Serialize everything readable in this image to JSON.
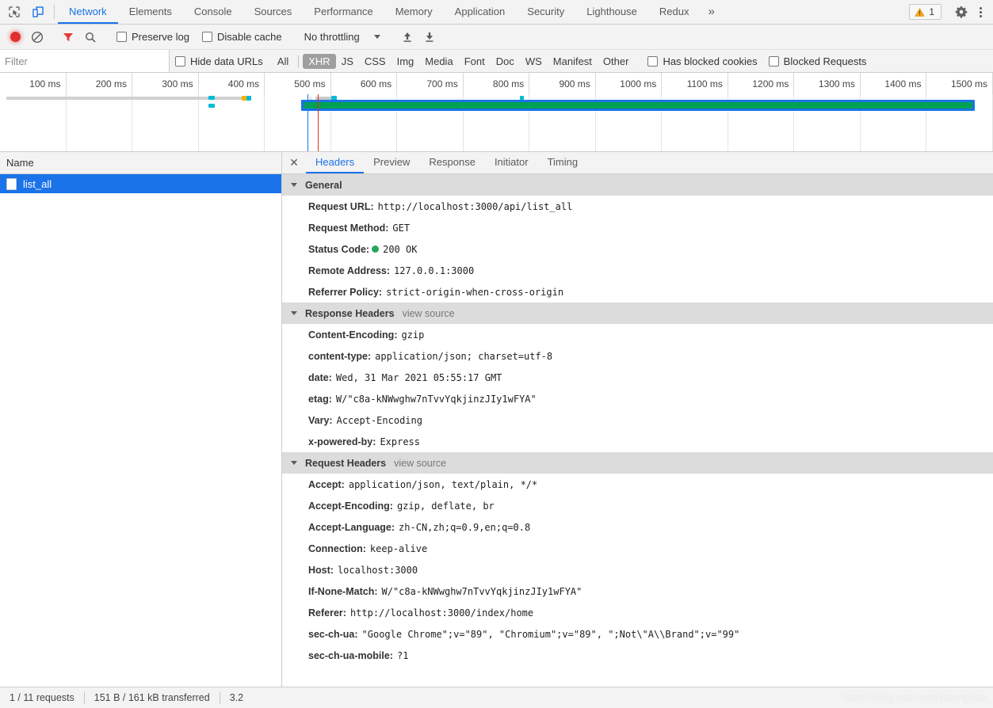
{
  "window": {
    "inspect_icon": "inspect-cursor-icon",
    "device_icon": "device-toolbar-icon"
  },
  "main_tabs": [
    {
      "label": "Network",
      "active": true
    },
    {
      "label": "Elements",
      "active": false
    },
    {
      "label": "Console",
      "active": false
    },
    {
      "label": "Sources",
      "active": false
    },
    {
      "label": "Performance",
      "active": false
    },
    {
      "label": "Memory",
      "active": false
    },
    {
      "label": "Application",
      "active": false
    },
    {
      "label": "Security",
      "active": false
    },
    {
      "label": "Lighthouse",
      "active": false
    },
    {
      "label": "Redux",
      "active": false
    }
  ],
  "main_tabs_overflow": "»",
  "warnings": {
    "count": "1",
    "icon": "warning-triangle-icon"
  },
  "settings_icon": "gear-icon",
  "more_icon": "kebab-menu-icon",
  "controls": {
    "record_icon": "record-button-icon",
    "clear_icon": "clear-icon",
    "filter_icon": "filter-funnel-icon",
    "search_icon": "search-icon",
    "preserve_log": "Preserve log",
    "disable_cache": "Disable cache",
    "throttling": "No throttling",
    "import_icon": "import-har-icon",
    "export_icon": "export-har-icon"
  },
  "filterbar": {
    "placeholder": "Filter",
    "value": "",
    "hide_data_urls": "Hide data URLs",
    "types": [
      {
        "label": "All",
        "selected": false
      },
      {
        "label": "XHR",
        "selected": true
      },
      {
        "label": "JS",
        "selected": false
      },
      {
        "label": "CSS",
        "selected": false
      },
      {
        "label": "Img",
        "selected": false
      },
      {
        "label": "Media",
        "selected": false
      },
      {
        "label": "Font",
        "selected": false
      },
      {
        "label": "Doc",
        "selected": false
      },
      {
        "label": "WS",
        "selected": false
      },
      {
        "label": "Manifest",
        "selected": false
      },
      {
        "label": "Other",
        "selected": false
      }
    ],
    "has_blocked_cookies": "Has blocked cookies",
    "blocked_requests": "Blocked Requests"
  },
  "overview": {
    "ticks": [
      "100 ms",
      "200 ms",
      "300 ms",
      "400 ms",
      "500 ms",
      "600 ms",
      "700 ms",
      "800 ms",
      "900 ms",
      "1000 ms",
      "1100 ms",
      "1200 ms",
      "1300 ms",
      "1400 ms",
      "1500 ms"
    ],
    "dom_content_loaded_color": "#1a73e8",
    "load_event_color": "#d93025",
    "request_color": "#00bcd4",
    "selected_request_color": "#00a152"
  },
  "requests_panel": {
    "column_header": "Name",
    "rows": [
      {
        "name": "list_all",
        "selected": true
      }
    ]
  },
  "detail_tabs": [
    {
      "label": "Headers",
      "active": true
    },
    {
      "label": "Preview",
      "active": false
    },
    {
      "label": "Response",
      "active": false
    },
    {
      "label": "Initiator",
      "active": false
    },
    {
      "label": "Timing",
      "active": false
    }
  ],
  "sections": [
    {
      "title": "General",
      "view_source": "",
      "rows": [
        {
          "key": "Request URL:",
          "value": "http://localhost:3000/api/list_all"
        },
        {
          "key": "Request Method:",
          "value": "GET"
        },
        {
          "key": "Status Code:",
          "value": "200 OK",
          "status_dot": true
        },
        {
          "key": "Remote Address:",
          "value": "127.0.0.1:3000"
        },
        {
          "key": "Referrer Policy:",
          "value": "strict-origin-when-cross-origin"
        }
      ]
    },
    {
      "title": "Response Headers",
      "view_source": "view source",
      "rows": [
        {
          "key": "Content-Encoding:",
          "value": "gzip"
        },
        {
          "key": "content-type:",
          "value": "application/json; charset=utf-8"
        },
        {
          "key": "date:",
          "value": "Wed, 31 Mar 2021 05:55:17 GMT"
        },
        {
          "key": "etag:",
          "value": "W/\"c8a-kNWwghw7nTvvYqkjinzJIy1wFYA\""
        },
        {
          "key": "Vary:",
          "value": "Accept-Encoding"
        },
        {
          "key": "x-powered-by:",
          "value": "Express"
        }
      ]
    },
    {
      "title": "Request Headers",
      "view_source": "view source",
      "rows": [
        {
          "key": "Accept:",
          "value": "application/json, text/plain, */*"
        },
        {
          "key": "Accept-Encoding:",
          "value": "gzip, deflate, br"
        },
        {
          "key": "Accept-Language:",
          "value": "zh-CN,zh;q=0.9,en;q=0.8"
        },
        {
          "key": "Connection:",
          "value": "keep-alive"
        },
        {
          "key": "Host:",
          "value": "localhost:3000"
        },
        {
          "key": "If-None-Match:",
          "value": "W/\"c8a-kNWwghw7nTvvYqkjinzJIy1wFYA\""
        },
        {
          "key": "Referer:",
          "value": "http://localhost:3000/index/home"
        },
        {
          "key": "sec-ch-ua:",
          "value": "\"Google Chrome\";v=\"89\", \"Chromium\";v=\"89\", \";Not\\\"A\\\\Brand\";v=\"99\""
        },
        {
          "key": "sec-ch-ua-mobile:",
          "value": "?1"
        }
      ]
    }
  ],
  "statusbar": {
    "requests": "1 / 11 requests",
    "transferred": "151 B / 161 kB transferred",
    "resources": "3.2"
  },
  "watermark": "https://blog.csdn.net/xutongbao"
}
